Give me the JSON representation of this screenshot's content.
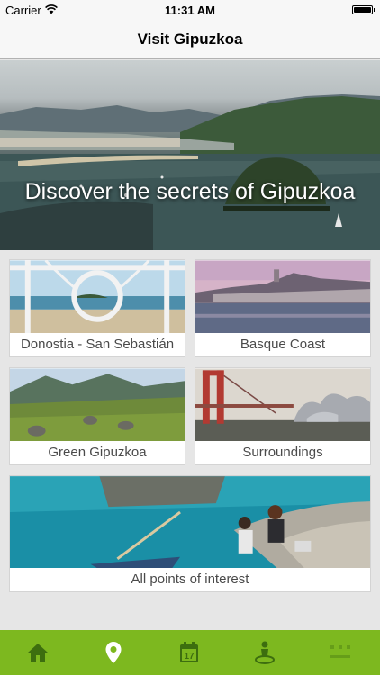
{
  "status_bar": {
    "carrier": "Carrier",
    "time": "11:31 AM"
  },
  "nav": {
    "title": "Visit Gipuzkoa"
  },
  "hero": {
    "caption": "Discover the secrets of Gipuzkoa"
  },
  "tiles": [
    {
      "label": "Donostia - San Sebastián"
    },
    {
      "label": "Basque Coast"
    },
    {
      "label": "Green Gipuzkoa"
    },
    {
      "label": "Surroundings"
    },
    {
      "label": "All points of interest"
    }
  ],
  "tab_bar": {
    "items": [
      {
        "icon": "home-icon"
      },
      {
        "icon": "map-pin-icon"
      },
      {
        "icon": "calendar-icon"
      },
      {
        "icon": "person-location-icon"
      },
      {
        "icon": "more-icon"
      }
    ]
  },
  "colors": {
    "tab_bar_background": "#7db81f",
    "tab_icon": "#3d6e0f",
    "nav_background": "#f7f7f7",
    "page_background": "#e6e6e6"
  }
}
